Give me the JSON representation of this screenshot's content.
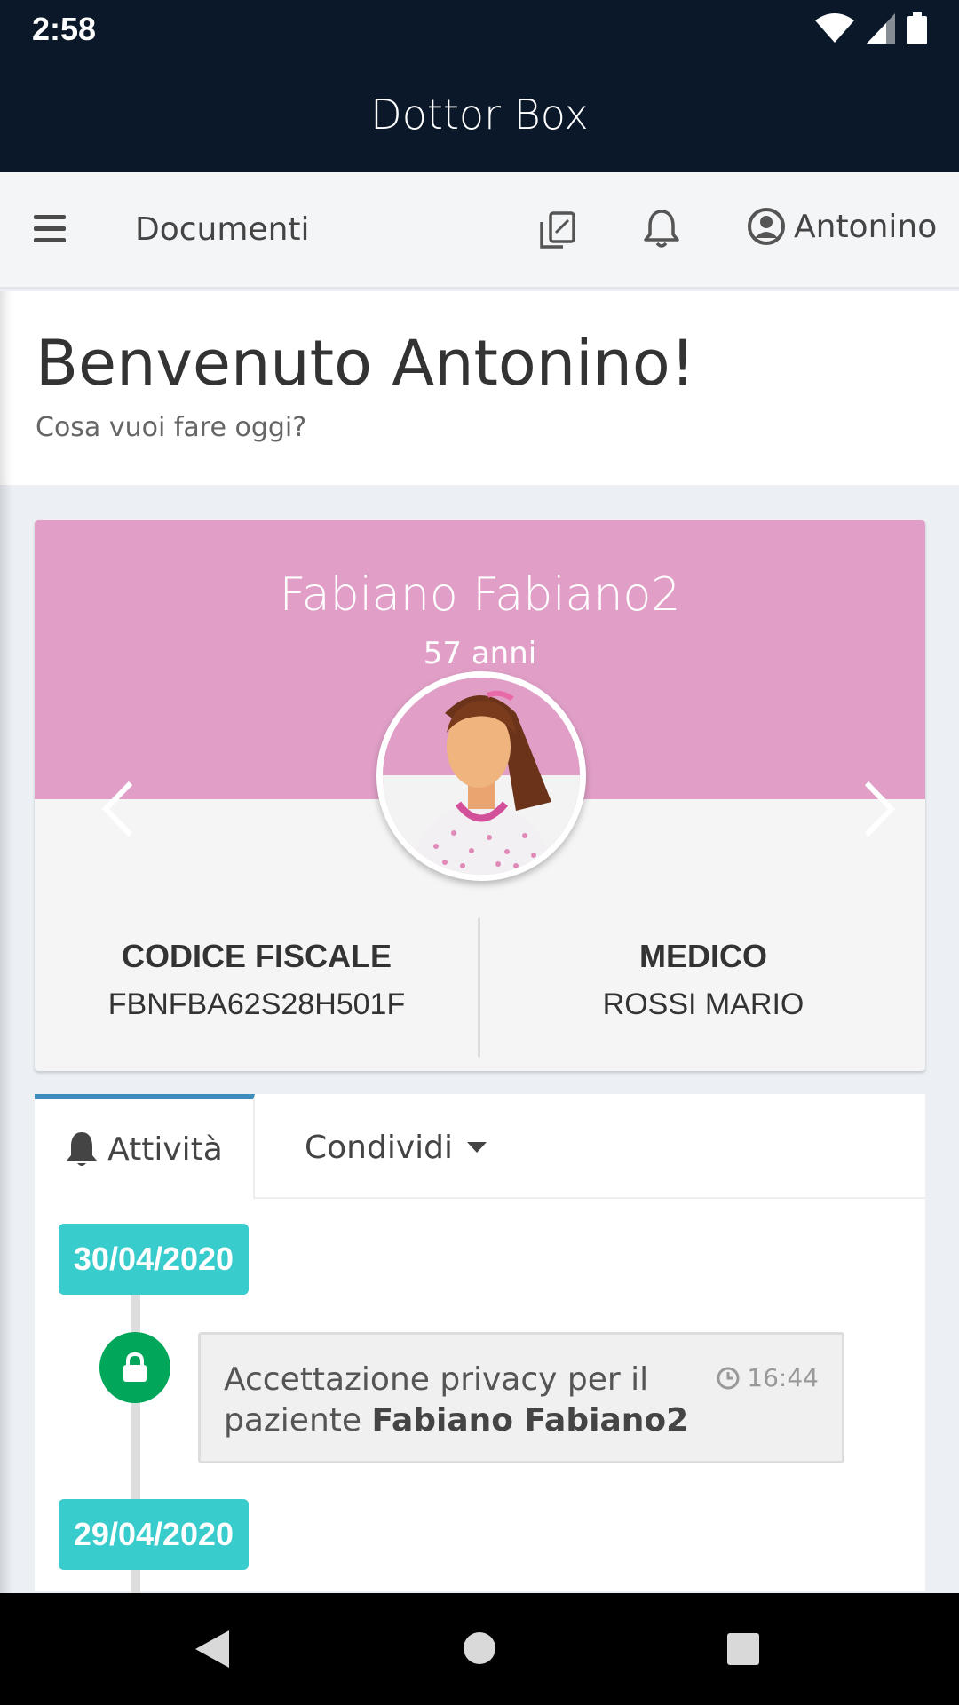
{
  "status_bar": {
    "time": "2:58",
    "icons": [
      "wifi-icon",
      "cellular-signal-icon",
      "battery-icon"
    ]
  },
  "app": {
    "title": "Dottor Box"
  },
  "navbar": {
    "menu_icon": "hamburger-menu-icon",
    "documents_label": "Documenti",
    "copy_icon": "copy-documents-icon",
    "bell_icon": "bell-icon",
    "user_icon": "user-circle-icon",
    "user_name": "Antonino"
  },
  "welcome": {
    "title": "Benvenuto Antonino!",
    "subtitle": "Cosa vuoi fare oggi?"
  },
  "patient": {
    "name": "Fabiano Fabiano2",
    "age": "57 anni",
    "header_color": "#e19fc7",
    "codice_fiscale_label": "CODICE FISCALE",
    "codice_fiscale_value": "FBNFBA62S28H501F",
    "medico_label": "MEDICO",
    "medico_value": "ROSSI MARIO"
  },
  "activity": {
    "tab_activity_label": "Attività",
    "tab_share_label": "Condividi",
    "active_tab_color": "#3c8dbc",
    "timeline": [
      {
        "date": "30/04/2020",
        "items": [
          {
            "icon": "lock-icon",
            "text_prefix": "Accettazione privacy per il paziente ",
            "text_bold": "Fabiano Fabiano2",
            "time": "16:44"
          }
        ]
      },
      {
        "date": "29/04/2020",
        "items": []
      }
    ],
    "date_color": "#39cccc",
    "event_color": "#00a65a"
  },
  "android_nav": {
    "back": "back-icon",
    "home": "home-icon",
    "recents": "recents-icon"
  }
}
